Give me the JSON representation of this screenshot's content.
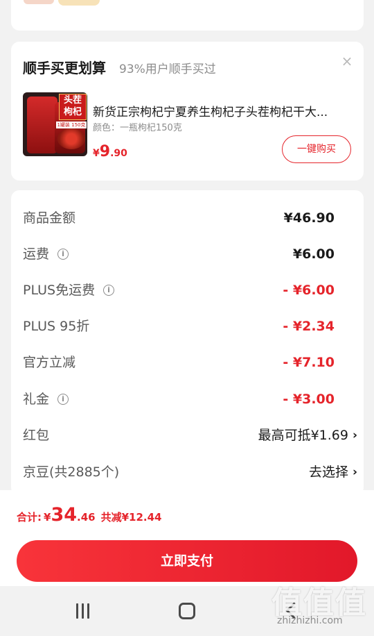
{
  "upsell": {
    "title": "顺手买更划算",
    "subtitle": "93%用户顺手买过",
    "close_glyph": "×",
    "product": {
      "image_label": "头茬\n枸杞",
      "image_badge": "1罐装 150克",
      "name": "新货正宗枸杞宁夏养生枸杞子头茬枸杞干大...",
      "spec": "颜色：一瓶枸杞150克",
      "price_symbol": "¥",
      "price_int": "9",
      "price_dec": ".90",
      "buy_label": "一键购买"
    }
  },
  "summary": {
    "rows": [
      {
        "label": "商品金额",
        "value": "¥46.90",
        "info": false,
        "style": "normal"
      },
      {
        "label": "运费",
        "value": "¥6.00",
        "info": true,
        "style": "normal"
      },
      {
        "label": "PLUS免运费",
        "value": "- ¥6.00",
        "info": true,
        "style": "red"
      },
      {
        "label": "PLUS 95折",
        "value": "- ¥2.34",
        "info": false,
        "style": "red"
      },
      {
        "label": "官方立减",
        "value": "- ¥7.10",
        "info": false,
        "style": "red"
      },
      {
        "label": "礼金",
        "value": "- ¥3.00",
        "info": true,
        "style": "red"
      },
      {
        "label": "红包",
        "value": "最高可抵¥1.69",
        "info": false,
        "style": "link"
      },
      {
        "label": "京豆(共2885个)",
        "value": "去选择",
        "info": false,
        "style": "link"
      }
    ],
    "info_glyph": "i",
    "chevron_glyph": "›"
  },
  "bottom": {
    "total_label": "合计:",
    "total_symbol": "¥",
    "total_int": "34",
    "total_dec": ".46",
    "savings": "共减¥12.44",
    "pay_label": "立即支付"
  },
  "watermark": {
    "glyphs": "值值值",
    "text": "zhizhizhi.com"
  },
  "colors": {
    "accent": "#e5242b",
    "pay_gradient_start": "#f8343a",
    "pay_gradient_end": "#e2182a"
  }
}
